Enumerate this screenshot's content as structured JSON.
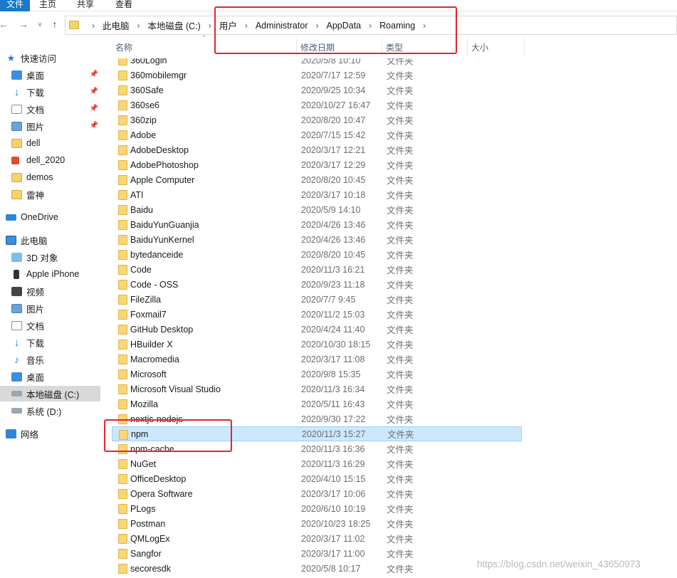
{
  "ribbon": {
    "tabs": [
      "文件",
      "主页",
      "共享",
      "查看"
    ]
  },
  "address": {
    "crumbs": [
      "此电脑",
      "本地磁盘 (C:)",
      "用户",
      "Administrator",
      "AppData",
      "Roaming"
    ]
  },
  "sidebar": {
    "items": [
      {
        "label": "快速访问",
        "icon": "star-icon"
      },
      {
        "label": "桌面",
        "icon": "desktop-icon",
        "pinned": true
      },
      {
        "label": "下载",
        "icon": "download-icon",
        "pinned": true
      },
      {
        "label": "文档",
        "icon": "document-icon",
        "pinned": true
      },
      {
        "label": "图片",
        "icon": "picture-icon",
        "pinned": true
      },
      {
        "label": "dell",
        "icon": "folder-icon"
      },
      {
        "label": "dell_2020",
        "icon": "folder-warning-icon"
      },
      {
        "label": "demos",
        "icon": "folder-icon"
      },
      {
        "label": "雷神",
        "icon": "folder-icon"
      },
      {
        "label": "OneDrive",
        "icon": "cloud-icon"
      },
      {
        "label": "此电脑",
        "icon": "computer-icon"
      },
      {
        "label": "3D 对象",
        "icon": "cube-icon"
      },
      {
        "label": "Apple iPhone",
        "icon": "phone-icon"
      },
      {
        "label": "视频",
        "icon": "video-icon"
      },
      {
        "label": "图片",
        "icon": "picture-icon"
      },
      {
        "label": "文档",
        "icon": "document-icon"
      },
      {
        "label": "下载",
        "icon": "download-icon"
      },
      {
        "label": "音乐",
        "icon": "music-icon"
      },
      {
        "label": "桌面",
        "icon": "desktop-icon"
      },
      {
        "label": "本地磁盘 (C:)",
        "icon": "drive-icon",
        "selected": true
      },
      {
        "label": "系统 (D:)",
        "icon": "drive-icon"
      },
      {
        "label": "网络",
        "icon": "network-icon"
      }
    ]
  },
  "columns": {
    "name": "名称",
    "date": "修改日期",
    "type": "类型",
    "size": "大小"
  },
  "files": [
    {
      "name": "360Login",
      "date": "2020/5/8 10:10",
      "type": "文件夹"
    },
    {
      "name": "360mobilemgr",
      "date": "2020/7/17 12:59",
      "type": "文件夹"
    },
    {
      "name": "360Safe",
      "date": "2020/9/25 10:34",
      "type": "文件夹"
    },
    {
      "name": "360se6",
      "date": "2020/10/27 16:47",
      "type": "文件夹"
    },
    {
      "name": "360zip",
      "date": "2020/8/20 10:47",
      "type": "文件夹"
    },
    {
      "name": "Adobe",
      "date": "2020/7/15 15:42",
      "type": "文件夹"
    },
    {
      "name": "AdobeDesktop",
      "date": "2020/3/17 12:21",
      "type": "文件夹"
    },
    {
      "name": "AdobePhotoshop",
      "date": "2020/3/17 12:29",
      "type": "文件夹"
    },
    {
      "name": "Apple Computer",
      "date": "2020/8/20 10:45",
      "type": "文件夹"
    },
    {
      "name": "ATI",
      "date": "2020/3/17 10:18",
      "type": "文件夹"
    },
    {
      "name": "Baidu",
      "date": "2020/5/9 14:10",
      "type": "文件夹"
    },
    {
      "name": "BaiduYunGuanjia",
      "date": "2020/4/26 13:46",
      "type": "文件夹"
    },
    {
      "name": "BaiduYunKernel",
      "date": "2020/4/26 13:46",
      "type": "文件夹"
    },
    {
      "name": "bytedanceide",
      "date": "2020/8/20 10:45",
      "type": "文件夹"
    },
    {
      "name": "Code",
      "date": "2020/11/3 16:21",
      "type": "文件夹"
    },
    {
      "name": "Code - OSS",
      "date": "2020/9/23 11:18",
      "type": "文件夹"
    },
    {
      "name": "FileZilla",
      "date": "2020/7/7 9:45",
      "type": "文件夹"
    },
    {
      "name": "Foxmail7",
      "date": "2020/11/2 15:03",
      "type": "文件夹"
    },
    {
      "name": "GitHub Desktop",
      "date": "2020/4/24 11:40",
      "type": "文件夹"
    },
    {
      "name": "HBuilder X",
      "date": "2020/10/30 18:15",
      "type": "文件夹"
    },
    {
      "name": "Macromedia",
      "date": "2020/3/17 11:08",
      "type": "文件夹"
    },
    {
      "name": "Microsoft",
      "date": "2020/9/8 15:35",
      "type": "文件夹"
    },
    {
      "name": "Microsoft Visual Studio",
      "date": "2020/11/3 16:34",
      "type": "文件夹"
    },
    {
      "name": "Mozilla",
      "date": "2020/5/11 16:43",
      "type": "文件夹"
    },
    {
      "name": "nextjs-nodejs",
      "date": "2020/9/30 17:22",
      "type": "文件夹"
    },
    {
      "name": "npm",
      "date": "2020/11/3 15:27",
      "type": "文件夹",
      "selected": true
    },
    {
      "name": "npm-cache",
      "date": "2020/11/3 16:36",
      "type": "文件夹"
    },
    {
      "name": "NuGet",
      "date": "2020/11/3 16:29",
      "type": "文件夹"
    },
    {
      "name": "OfficeDesktop",
      "date": "2020/4/10 15:15",
      "type": "文件夹"
    },
    {
      "name": "Opera Software",
      "date": "2020/3/17 10:06",
      "type": "文件夹"
    },
    {
      "name": "PLogs",
      "date": "2020/6/10 10:19",
      "type": "文件夹"
    },
    {
      "name": "Postman",
      "date": "2020/10/23 18:25",
      "type": "文件夹"
    },
    {
      "name": "QMLogEx",
      "date": "2020/3/17 11:02",
      "type": "文件夹"
    },
    {
      "name": "Sangfor",
      "date": "2020/3/17 11:00",
      "type": "文件夹"
    },
    {
      "name": "secoresdk",
      "date": "2020/5/8 10:17",
      "type": "文件夹"
    }
  ],
  "watermark": "https://blog.csdn.net/weixin_43650973"
}
